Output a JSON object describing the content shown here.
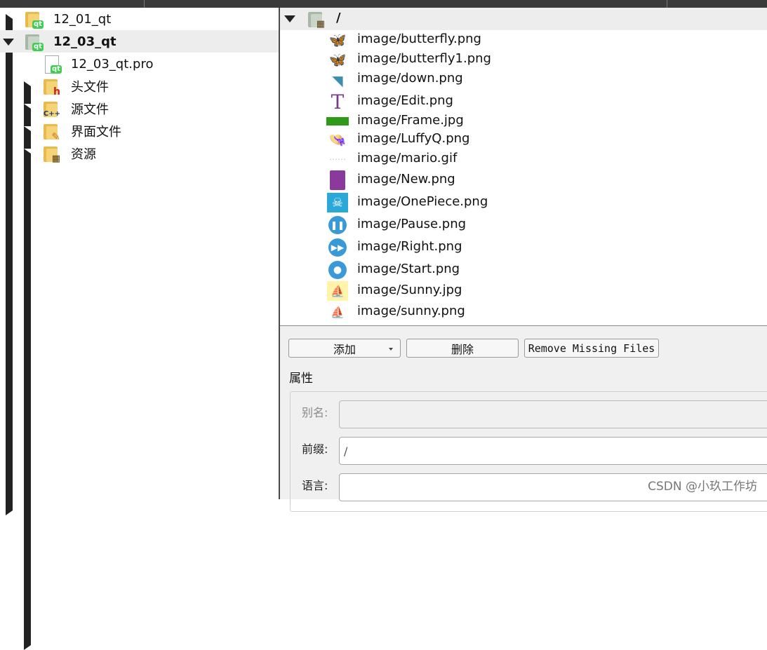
{
  "project_tree": [
    {
      "label": "12_01_qt",
      "expanded": false,
      "selected": false,
      "icon": "qt-project-folder-icon"
    },
    {
      "label": "12_03_qt",
      "expanded": true,
      "selected": true,
      "icon": "qt-project-folder-icon"
    },
    {
      "label": "12_03_qt.pro",
      "icon": "qt-pro-file-icon"
    },
    {
      "label": "头文件",
      "expanded": false,
      "icon": "headers-folder-icon"
    },
    {
      "label": "源文件",
      "expanded": false,
      "icon": "sources-folder-icon"
    },
    {
      "label": "界面文件",
      "expanded": false,
      "icon": "forms-folder-icon"
    },
    {
      "label": "资源",
      "expanded": false,
      "icon": "resources-folder-icon"
    }
  ],
  "resource_editor": {
    "root_prefix": "/",
    "files": [
      "image/butterfly.png",
      "image/butterfly1.png",
      "image/down.png",
      "image/Edit.png",
      "image/Frame.jpg",
      "image/LuffyQ.png",
      "image/mario.gif",
      "image/New.png",
      "image/OnePiece.png",
      "image/Pause.png",
      "image/Right.png",
      "image/Start.png",
      "image/Sunny.jpg",
      "image/sunny.png"
    ],
    "buttons": {
      "add": "添加",
      "remove": "删除",
      "remove_missing": "Remove Missing Files"
    },
    "properties": {
      "title": "属性",
      "alias_label": "别名:",
      "alias_value": "",
      "prefix_label": "前缀:",
      "prefix_value": "/",
      "language_label": "语言:",
      "language_value": ""
    }
  },
  "watermark": "CSDN @小玖工作坊",
  "colors": {
    "selection": "#ededed",
    "panel": "#f0f0f0",
    "topbar": "#3a3a3a",
    "qt_green": "#41cd52"
  }
}
